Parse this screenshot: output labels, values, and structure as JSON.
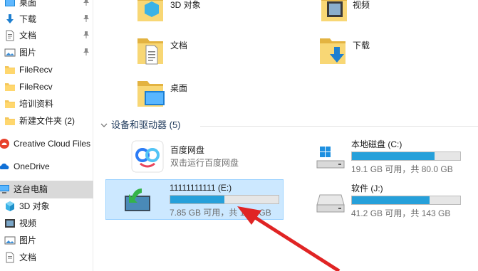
{
  "sidebar": {
    "items": [
      {
        "label": "桌面",
        "icon": "desktop-icon"
      },
      {
        "label": "下载",
        "icon": "download-arrow-icon"
      },
      {
        "label": "文档",
        "icon": "document-icon"
      },
      {
        "label": "图片",
        "icon": "pictures-icon"
      },
      {
        "label": "FileRecv",
        "icon": "folder-icon"
      },
      {
        "label": "FileRecv",
        "icon": "folder-icon"
      },
      {
        "label": "培训资料",
        "icon": "folder-icon"
      },
      {
        "label": "新建文件夹 (2)",
        "icon": "folder-icon"
      },
      {
        "label": "Creative Cloud Files",
        "icon": "creative-cloud-icon"
      },
      {
        "label": "OneDrive",
        "icon": "onedrive-icon"
      },
      {
        "label": "这台电脑",
        "icon": "this-pc-icon"
      },
      {
        "label": "3D 对象",
        "icon": "3d-objects-icon"
      },
      {
        "label": "视频",
        "icon": "videos-icon"
      },
      {
        "label": "图片",
        "icon": "pictures-icon"
      },
      {
        "label": "文档",
        "icon": "document-icon"
      }
    ]
  },
  "folders": {
    "obj3d": "3D 对象",
    "videos": "视频",
    "documents": "文档",
    "downloads": "下载",
    "desktop": "桌面"
  },
  "devices_group": {
    "label": "设备和驱动器 (5)"
  },
  "devices": {
    "baidu": {
      "name": "百度网盘",
      "sub": "双击运行百度网盘"
    },
    "c_drive": {
      "name": "本地磁盘 (C:)",
      "free": "19.1 GB 可用，共 80.0 GB",
      "used_fraction": 0.76
    },
    "e_drive": {
      "name": "11111111111 (E:)",
      "free": "7.85 GB 可用，共 14.6 GB",
      "used_fraction": 0.5
    },
    "j_drive": {
      "name": "软件 (J:)",
      "free": "41.2 GB 可用，共 143 GB",
      "used_fraction": 0.72
    }
  },
  "colors": {
    "selection": "#cce8ff",
    "bar_fill": "#26a0da",
    "annotation_arrow": "#e02424"
  }
}
